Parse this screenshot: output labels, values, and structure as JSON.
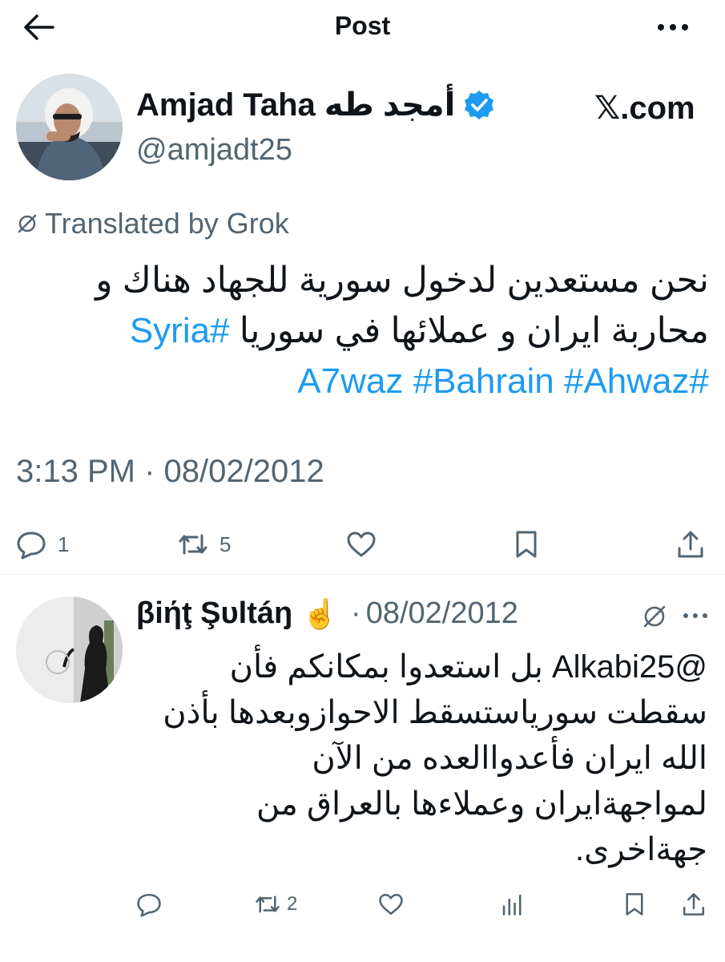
{
  "header": {
    "title": "Post"
  },
  "icons": {
    "back": "arrow-left-icon",
    "more": "more-dots-icon"
  },
  "colors": {
    "link": "#1d9bf0",
    "muted": "#536471",
    "text": "#0f1419",
    "verified": "#1d9bf0"
  },
  "post": {
    "author_name": "Amjad Taha أمجد طه",
    "author_handle": "@amjadt25",
    "watermark": "𝕏.com",
    "translated_label": "Translated by Grok",
    "body_line1": "نحن مستعدين لدخول سورية  للجهاد هناك و",
    "body_line2_text": "محاربة ايران و عملائها في سوريا",
    "hashtag_syria": "#Syria",
    "hashtag_a7waz": "#A7waz",
    "hashtag_bahrain": "#Bahrain",
    "hashtag_ahwaz": "#Ahwaz",
    "timestamp": "3:13 PM · 08/02/2012",
    "reply_count": "1",
    "repost_count": "5"
  },
  "reply": {
    "author_name": "βiήţ Şυltáŋ",
    "emoji": "☝️",
    "date": "08/02/2012",
    "dot": "·",
    "body": "@Alkabi25 بل استعدوا بمكانكم فأن سقطت سورياستسقط الاحوازوبعدها بأذن الله ايران فأعدواالعده من الآن لمواجهةايران وعملاءها بالعراق من جهةاخرى.",
    "repost_count": "2"
  }
}
